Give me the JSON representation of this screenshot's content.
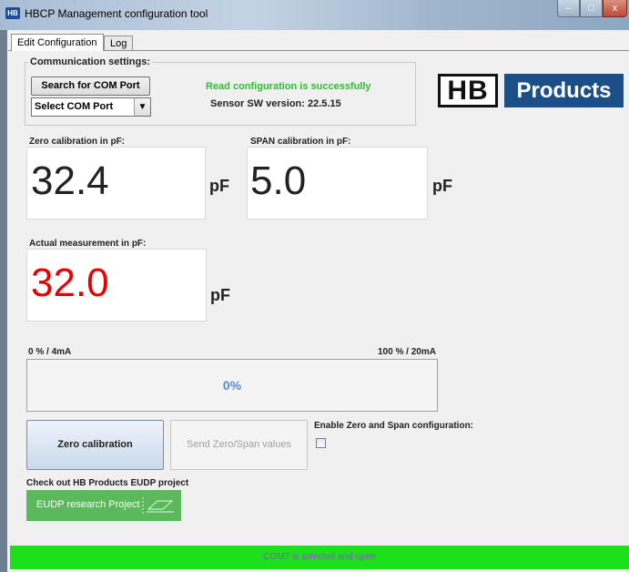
{
  "window": {
    "title": "HBCP Management configuration tool",
    "app_icon": "HB",
    "controls": {
      "minimize": "–",
      "maximize": "□",
      "close": "x"
    }
  },
  "tabs": [
    {
      "label": "Edit Configuration",
      "selected": true
    },
    {
      "label": "Log",
      "selected": false
    }
  ],
  "communication": {
    "group_title": "Communication settings:",
    "search_button": "Search for COM Port",
    "com_select": {
      "value": "Select COM Port",
      "arrow": "▼"
    },
    "status_message": "Read configuration is successfully",
    "sw_version": "Sensor SW version: 22.5.15"
  },
  "logo": {
    "left": "HB",
    "right": "Products"
  },
  "zero_calibration": {
    "label": "Zero calibration in pF:",
    "value": "32.4",
    "unit": "pF"
  },
  "span_calibration": {
    "label": "SPAN calibration in pF:",
    "value": "5.0",
    "unit": "pF"
  },
  "actual_measurement": {
    "label": "Actual measurement in pF:",
    "value": "32.0",
    "unit": "pF",
    "value_color": "#e80000"
  },
  "range": {
    "low_label": "0 % / 4mA",
    "high_label": "100 % / 20mA",
    "progress_text": "0%",
    "progress_fraction": 0
  },
  "actions": {
    "zero_button": "Zero calibration",
    "send_button": "Send Zero/Span values",
    "send_enabled": false,
    "enable_label": "Enable Zero and Span configuration:",
    "enable_checked": false
  },
  "eudp": {
    "label": "Check out HB Products EUDP project",
    "button": "EUDP research Project",
    "button_color": "#5bb85b"
  },
  "status_bar": {
    "text": "COM7 is selected and open",
    "color": "#1be01b"
  }
}
